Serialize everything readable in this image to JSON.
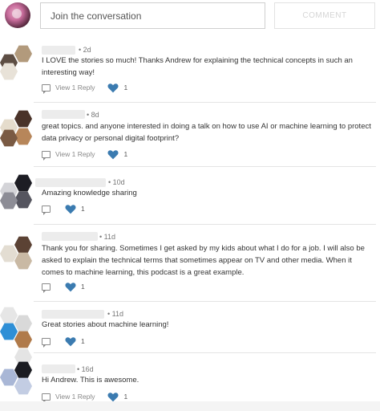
{
  "composer": {
    "placeholder": "Join the conversation",
    "button_label": "COMMENT"
  },
  "heart_color": "#3b7bb0",
  "comments": [
    {
      "time": "2d",
      "text": "I LOVE the stories so much! Thanks Andrew for explaining the technical concepts in such an interesting way!",
      "reply_label": "View 1 Reply",
      "likes": "1",
      "avatar_colors": [
        "#b29a7c",
        "#5d4e44",
        "#e8e2d8"
      ]
    },
    {
      "time": "8d",
      "text": "great topics. and anyone interested in doing a talk on how to use AI or machine learning to protect data privacy or personal digital footprint?",
      "reply_label": "View 1 Reply",
      "likes": "1",
      "avatar_colors": [
        "#4a3329",
        "#b7865a",
        "#e5dccc",
        "#7a5a43"
      ]
    },
    {
      "time": "10d",
      "text": "Amazing knowledge sharing",
      "reply_label": "",
      "likes": "1",
      "avatar_colors": [
        "#1d1d24",
        "#8d8d96",
        "#d4d4d8",
        "#55555f"
      ]
    },
    {
      "time": "11d",
      "text": "Thank you for sharing. Sometimes I get asked by my kids about what I do for a job. I will also be asked to explain the technical terms that sometimes appear on TV and other media. When it comes to machine learning, this podcast is a great example.",
      "reply_label": "",
      "likes": "1",
      "avatar_colors": [
        "#5b4234",
        "#c9b9a4",
        "#e3ddd2"
      ]
    },
    {
      "time": "11d",
      "text": "Great stories about machine learning!",
      "reply_label": "",
      "likes": "1",
      "avatar_colors": [
        "#e6e6e6",
        "#2f8fd6",
        "#b07a4a",
        "#d9d9d9"
      ]
    },
    {
      "time": "16d",
      "text": "Hi Andrew. This is awesome.",
      "reply_label": "View 1 Reply",
      "likes": "1",
      "avatar_colors": [
        "#e4e4e4",
        "#1b1c22",
        "#a9b7d6",
        "#c3cde3"
      ]
    }
  ]
}
